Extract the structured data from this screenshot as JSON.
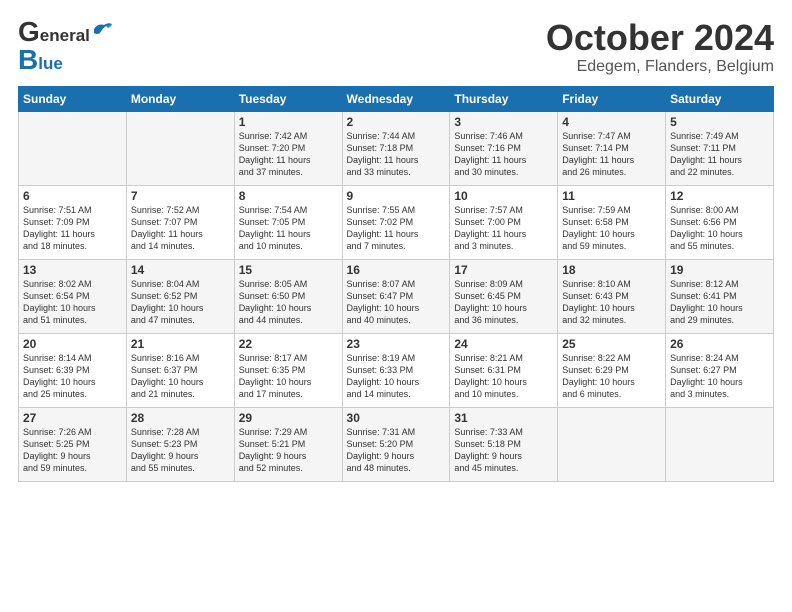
{
  "header": {
    "logo_general": "General",
    "logo_blue": "Blue",
    "title": "October 2024",
    "location": "Edegem, Flanders, Belgium"
  },
  "weekdays": [
    "Sunday",
    "Monday",
    "Tuesday",
    "Wednesday",
    "Thursday",
    "Friday",
    "Saturday"
  ],
  "weeks": [
    [
      {
        "day": "",
        "info": ""
      },
      {
        "day": "",
        "info": ""
      },
      {
        "day": "1",
        "info": "Sunrise: 7:42 AM\nSunset: 7:20 PM\nDaylight: 11 hours\nand 37 minutes."
      },
      {
        "day": "2",
        "info": "Sunrise: 7:44 AM\nSunset: 7:18 PM\nDaylight: 11 hours\nand 33 minutes."
      },
      {
        "day": "3",
        "info": "Sunrise: 7:46 AM\nSunset: 7:16 PM\nDaylight: 11 hours\nand 30 minutes."
      },
      {
        "day": "4",
        "info": "Sunrise: 7:47 AM\nSunset: 7:14 PM\nDaylight: 11 hours\nand 26 minutes."
      },
      {
        "day": "5",
        "info": "Sunrise: 7:49 AM\nSunset: 7:11 PM\nDaylight: 11 hours\nand 22 minutes."
      }
    ],
    [
      {
        "day": "6",
        "info": "Sunrise: 7:51 AM\nSunset: 7:09 PM\nDaylight: 11 hours\nand 18 minutes."
      },
      {
        "day": "7",
        "info": "Sunrise: 7:52 AM\nSunset: 7:07 PM\nDaylight: 11 hours\nand 14 minutes."
      },
      {
        "day": "8",
        "info": "Sunrise: 7:54 AM\nSunset: 7:05 PM\nDaylight: 11 hours\nand 10 minutes."
      },
      {
        "day": "9",
        "info": "Sunrise: 7:55 AM\nSunset: 7:02 PM\nDaylight: 11 hours\nand 7 minutes."
      },
      {
        "day": "10",
        "info": "Sunrise: 7:57 AM\nSunset: 7:00 PM\nDaylight: 11 hours\nand 3 minutes."
      },
      {
        "day": "11",
        "info": "Sunrise: 7:59 AM\nSunset: 6:58 PM\nDaylight: 10 hours\nand 59 minutes."
      },
      {
        "day": "12",
        "info": "Sunrise: 8:00 AM\nSunset: 6:56 PM\nDaylight: 10 hours\nand 55 minutes."
      }
    ],
    [
      {
        "day": "13",
        "info": "Sunrise: 8:02 AM\nSunset: 6:54 PM\nDaylight: 10 hours\nand 51 minutes."
      },
      {
        "day": "14",
        "info": "Sunrise: 8:04 AM\nSunset: 6:52 PM\nDaylight: 10 hours\nand 47 minutes."
      },
      {
        "day": "15",
        "info": "Sunrise: 8:05 AM\nSunset: 6:50 PM\nDaylight: 10 hours\nand 44 minutes."
      },
      {
        "day": "16",
        "info": "Sunrise: 8:07 AM\nSunset: 6:47 PM\nDaylight: 10 hours\nand 40 minutes."
      },
      {
        "day": "17",
        "info": "Sunrise: 8:09 AM\nSunset: 6:45 PM\nDaylight: 10 hours\nand 36 minutes."
      },
      {
        "day": "18",
        "info": "Sunrise: 8:10 AM\nSunset: 6:43 PM\nDaylight: 10 hours\nand 32 minutes."
      },
      {
        "day": "19",
        "info": "Sunrise: 8:12 AM\nSunset: 6:41 PM\nDaylight: 10 hours\nand 29 minutes."
      }
    ],
    [
      {
        "day": "20",
        "info": "Sunrise: 8:14 AM\nSunset: 6:39 PM\nDaylight: 10 hours\nand 25 minutes."
      },
      {
        "day": "21",
        "info": "Sunrise: 8:16 AM\nSunset: 6:37 PM\nDaylight: 10 hours\nand 21 minutes."
      },
      {
        "day": "22",
        "info": "Sunrise: 8:17 AM\nSunset: 6:35 PM\nDaylight: 10 hours\nand 17 minutes."
      },
      {
        "day": "23",
        "info": "Sunrise: 8:19 AM\nSunset: 6:33 PM\nDaylight: 10 hours\nand 14 minutes."
      },
      {
        "day": "24",
        "info": "Sunrise: 8:21 AM\nSunset: 6:31 PM\nDaylight: 10 hours\nand 10 minutes."
      },
      {
        "day": "25",
        "info": "Sunrise: 8:22 AM\nSunset: 6:29 PM\nDaylight: 10 hours\nand 6 minutes."
      },
      {
        "day": "26",
        "info": "Sunrise: 8:24 AM\nSunset: 6:27 PM\nDaylight: 10 hours\nand 3 minutes."
      }
    ],
    [
      {
        "day": "27",
        "info": "Sunrise: 7:26 AM\nSunset: 5:25 PM\nDaylight: 9 hours\nand 59 minutes."
      },
      {
        "day": "28",
        "info": "Sunrise: 7:28 AM\nSunset: 5:23 PM\nDaylight: 9 hours\nand 55 minutes."
      },
      {
        "day": "29",
        "info": "Sunrise: 7:29 AM\nSunset: 5:21 PM\nDaylight: 9 hours\nand 52 minutes."
      },
      {
        "day": "30",
        "info": "Sunrise: 7:31 AM\nSunset: 5:20 PM\nDaylight: 9 hours\nand 48 minutes."
      },
      {
        "day": "31",
        "info": "Sunrise: 7:33 AM\nSunset: 5:18 PM\nDaylight: 9 hours\nand 45 minutes."
      },
      {
        "day": "",
        "info": ""
      },
      {
        "day": "",
        "info": ""
      }
    ]
  ]
}
